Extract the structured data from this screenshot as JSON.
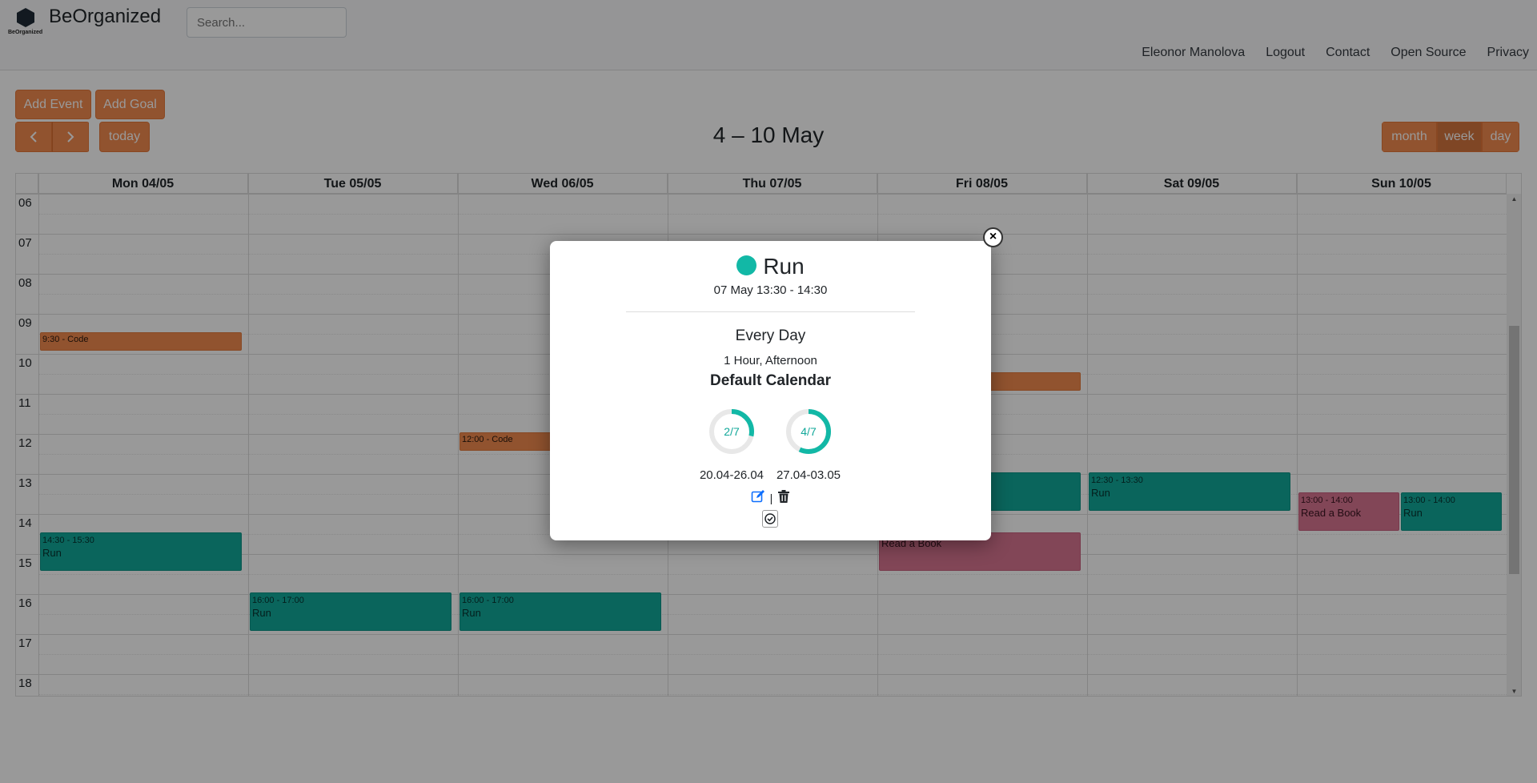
{
  "brand": {
    "name": "BeOrganized",
    "logo_text": "BeOrganized"
  },
  "search": {
    "placeholder": "Search..."
  },
  "nav": {
    "user": "Eleonor Manolova",
    "logout": "Logout",
    "contact": "Contact",
    "open_source": "Open Source",
    "privacy": "Privacy"
  },
  "toolbar": {
    "add_event": "Add Event",
    "add_goal": "Add Goal",
    "today": "today",
    "prev_icon": "chevron-left-icon",
    "next_icon": "chevron-right-icon"
  },
  "calendar": {
    "title": "4 – 10 May",
    "views": [
      "month",
      "week",
      "day"
    ],
    "active_view": "week",
    "days": [
      "Mon 04/05",
      "Tue 05/05",
      "Wed 06/05",
      "Thu 07/05",
      "Fri 08/05",
      "Sat 09/05",
      "Sun 10/05"
    ],
    "hours": [
      "06",
      "07",
      "08",
      "09",
      "10",
      "11",
      "12",
      "13",
      "14",
      "15",
      "16",
      "17",
      "18"
    ],
    "events": [
      {
        "time": "9:30 - Code",
        "name": ""
      },
      {
        "time": "12:00 - Code",
        "name": ""
      },
      {
        "time": "14:30 - 15:30",
        "name": "Run"
      },
      {
        "time": "16:00 - 17:00",
        "name": "Run"
      },
      {
        "time": "16:00 - 17:00",
        "name": "Run"
      },
      {
        "time": "12:30 - 13:30",
        "name": "Run"
      },
      {
        "time": "13:00 - 14:00",
        "name": "Read a Book"
      },
      {
        "time": "13:00 - 14:00",
        "name": "Run"
      },
      {
        "time": "",
        "name": "Read a Book"
      }
    ],
    "colors": {
      "code": "#f28a4f",
      "run": "#12a89a",
      "book": "#d97592"
    }
  },
  "modal": {
    "title": "Run",
    "dot_color": "#12b8a6",
    "time": "07 May 13:30 - 14:30",
    "frequency": "Every Day",
    "duration": "1 Hour, Afternoon",
    "calendar": "Default Calendar",
    "progress": [
      {
        "label": "2/7",
        "fraction": 0.2857,
        "week": "20.04-26.04"
      },
      {
        "label": "4/7",
        "fraction": 0.5714,
        "week": "27.04-03.05"
      }
    ],
    "separator": "|",
    "close_symbol": "×"
  }
}
